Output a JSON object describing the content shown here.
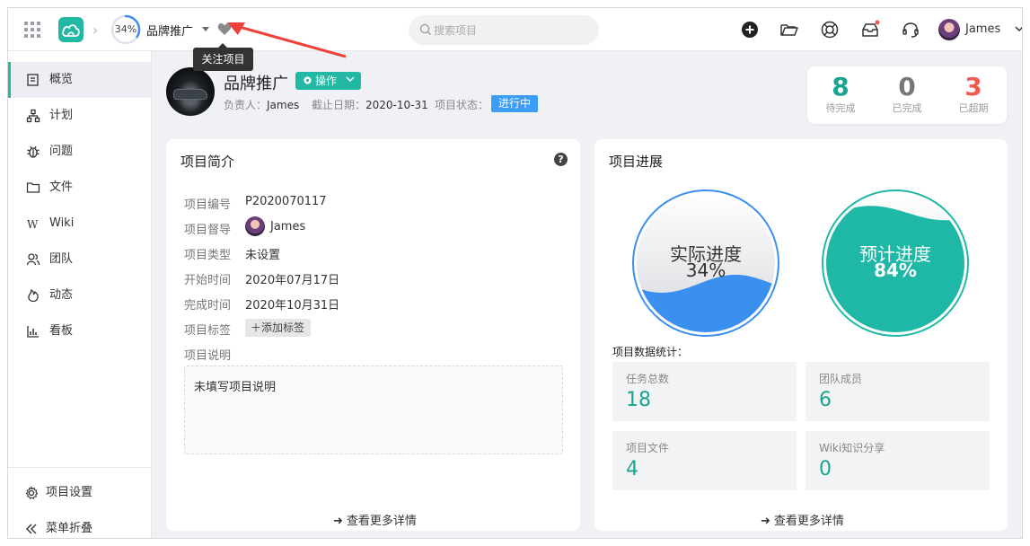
{
  "topbar": {
    "progress_label": "34%",
    "progress_value": 0.34,
    "project_name": "品牌推广",
    "search_placeholder": "搜索项目",
    "user_name": "James",
    "tooltip_follow": "关注项目",
    "icons": [
      "apps-grid-icon",
      "cloud-logo-icon",
      "chevron-right-icon",
      "heart-icon",
      "search-icon",
      "plus-circle-icon",
      "folder-open-icon",
      "lifebuoy-icon",
      "inbox-icon",
      "headset-icon",
      "chevron-down-icon"
    ]
  },
  "sidebar": {
    "items": [
      {
        "label": "概览",
        "icon": "overview-icon",
        "active": true
      },
      {
        "label": "计划",
        "icon": "plan-icon"
      },
      {
        "label": "问题",
        "icon": "bug-icon"
      },
      {
        "label": "文件",
        "icon": "folder-icon"
      },
      {
        "label": "Wiki",
        "icon": "wiki-icon"
      },
      {
        "label": "团队",
        "icon": "team-icon"
      },
      {
        "label": "动态",
        "icon": "activity-icon"
      },
      {
        "label": "看板",
        "icon": "chart-icon"
      }
    ],
    "settings_label": "项目设置",
    "collapse_label": "菜单折叠"
  },
  "header": {
    "title": "品牌推广",
    "op_button": "操作",
    "owner_label": "负责人：",
    "owner": "James",
    "deadline_label": "截止日期：",
    "deadline": "2020-10-31",
    "status_label": "项目状态：",
    "status": "进行中",
    "accent_color": "#22b8a4",
    "status_color": "#3b9df5"
  },
  "stats": {
    "pending_num": "8",
    "pending_label": "待完成",
    "pending_color": "#1aa392",
    "done_num": "0",
    "done_label": "已完成",
    "done_color": "#777777",
    "overdue_num": "3",
    "overdue_label": "已超期",
    "overdue_color": "#f05a4f"
  },
  "intro": {
    "title": "项目简介",
    "help": "?",
    "rows": [
      {
        "label": "项目编号",
        "value": "P2020070117"
      },
      {
        "label": "项目督导",
        "value": "James"
      },
      {
        "label": "项目类型",
        "value": "未设置"
      },
      {
        "label": "开始时间",
        "value": "2020年07月17日"
      },
      {
        "label": "完成时间",
        "value": "2020年10月31日"
      },
      {
        "label": "项目标签",
        "value": ""
      },
      {
        "label": "项目说明",
        "value": ""
      }
    ],
    "add_tag": "添加标签",
    "description": "未填写项目说明",
    "more": "查看更多详情"
  },
  "progress": {
    "title": "项目进展",
    "actual_label": "实际进度",
    "actual_value": "34%",
    "actual_fraction": 0.34,
    "planned_label": "预计进度",
    "planned_value": "84%",
    "planned_fraction": 0.84,
    "actual_color": "#3b8fef",
    "planned_color": "#1fb8a6",
    "stats_title": "项目数据统计：",
    "tiles": [
      {
        "label": "任务总数",
        "value": "18"
      },
      {
        "label": "团队成员",
        "value": "6"
      },
      {
        "label": "项目文件",
        "value": "4"
      },
      {
        "label": "Wiki知识分享",
        "value": "0"
      }
    ],
    "more": "查看更多详情"
  }
}
